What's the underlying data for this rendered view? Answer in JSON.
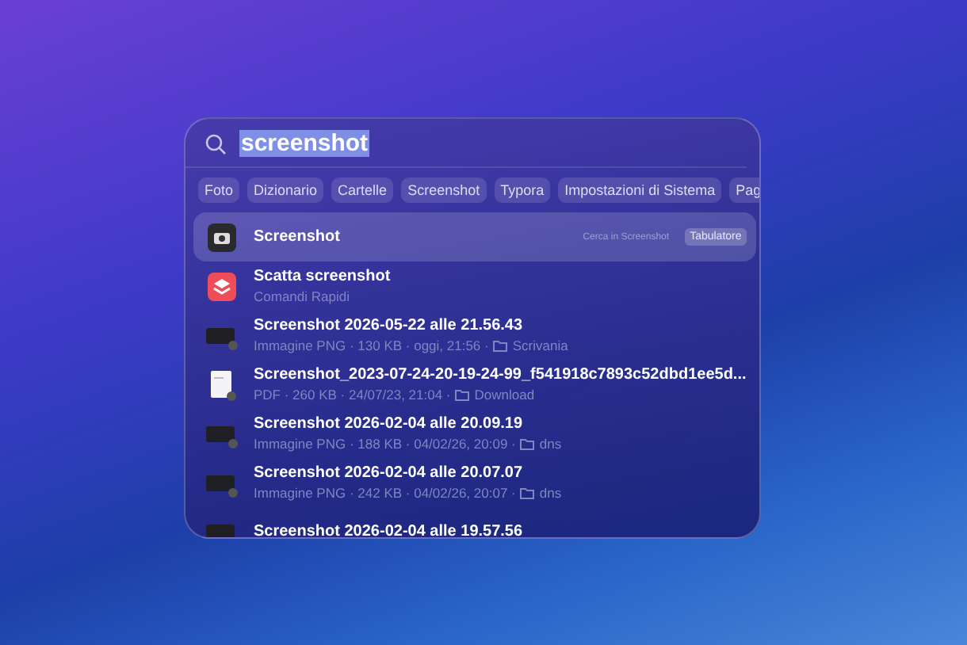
{
  "search": {
    "value": "screenshot"
  },
  "filters": [
    {
      "label": "Foto"
    },
    {
      "label": "Dizionario"
    },
    {
      "label": "Cartelle"
    },
    {
      "label": "Screenshot"
    },
    {
      "label": "Typora"
    },
    {
      "label": "Impostazioni di Sistema"
    },
    {
      "label": "Pag"
    }
  ],
  "results": [
    {
      "kind": "camera",
      "title": "Screenshot",
      "selected": true,
      "hint": "Cerca in Screenshot",
      "badge": "Tabulatore"
    },
    {
      "kind": "shortcut",
      "title": "Scatta screenshot",
      "selected": false,
      "subtitle": "Comandi Rapidi"
    },
    {
      "kind": "image",
      "title": "Screenshot 2026-05-22 alle 21.56.43",
      "selected": false,
      "subtitle": "Immagine PNG · 130 KB · oggi, 21:56 ·",
      "folder": "Scrivania"
    },
    {
      "kind": "pdf",
      "title": "Screenshot_2023-07-24-20-19-24-99_f541918c7893c52dbd1ee5d...",
      "selected": false,
      "subtitle": "PDF · 260 KB · 24/07/23, 21:04 ·",
      "folder": "Download"
    },
    {
      "kind": "image",
      "title": "Screenshot 2026-02-04 alle 20.09.19",
      "selected": false,
      "subtitle": "Immagine PNG · 188 KB · 04/02/26, 20:09 ·",
      "folder": "dns"
    },
    {
      "kind": "image",
      "title": "Screenshot 2026-02-04 alle 20.07.07",
      "selected": false,
      "subtitle": "Immagine PNG · 242 KB · 04/02/26, 20:07 ·",
      "folder": "dns"
    },
    {
      "kind": "image",
      "title": "Screenshot 2026-02-04 alle 19.57.56",
      "selected": false
    }
  ]
}
